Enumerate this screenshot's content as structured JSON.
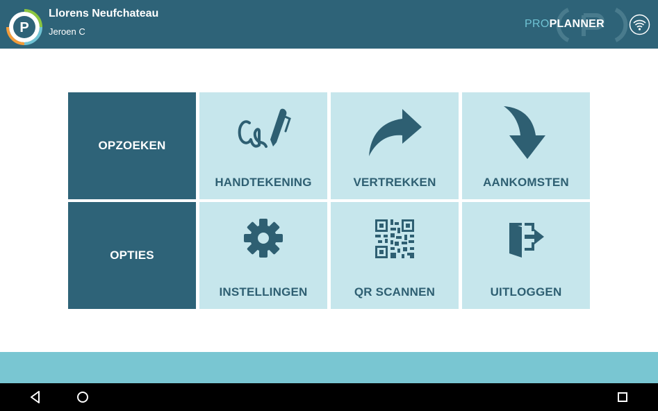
{
  "header": {
    "user_name": "Llorens Neufchateau",
    "user_sub": "Jeroen C",
    "brand_pro": "PRO",
    "brand_planner": "PLANNER",
    "logo_icon": "proplanner-p-logo-icon",
    "wifi_icon": "wifi-icon"
  },
  "menu": {
    "search_label": "OPZOEKEN",
    "options_label": "OPTIES",
    "signature_label": "HANDTEKENING",
    "departures_label": "VERTREKKEN",
    "arrivals_label": "AANKOMSTEN",
    "settings_label": "INSTELLINGEN",
    "qr_label": "QR SCANNEN",
    "logout_label": "UITLOGGEN"
  },
  "colors": {
    "header_bg": "#2e6378",
    "tile_dark": "#2e6378",
    "tile_light": "#c6e6ec",
    "icon": "#2e5f72",
    "bottom_band": "#79c6d2",
    "brand_accent": "#6fc3d4"
  },
  "icons": {
    "signature": "signature-pen-icon",
    "departures": "curved-arrow-right-icon",
    "arrivals": "curved-arrow-down-icon",
    "settings": "gear-icon",
    "qr": "qr-code-icon",
    "logout": "exit-door-icon"
  },
  "navbar": {
    "back_icon": "back-triangle-icon",
    "home_icon": "home-circle-icon",
    "recents_icon": "recents-square-icon"
  }
}
